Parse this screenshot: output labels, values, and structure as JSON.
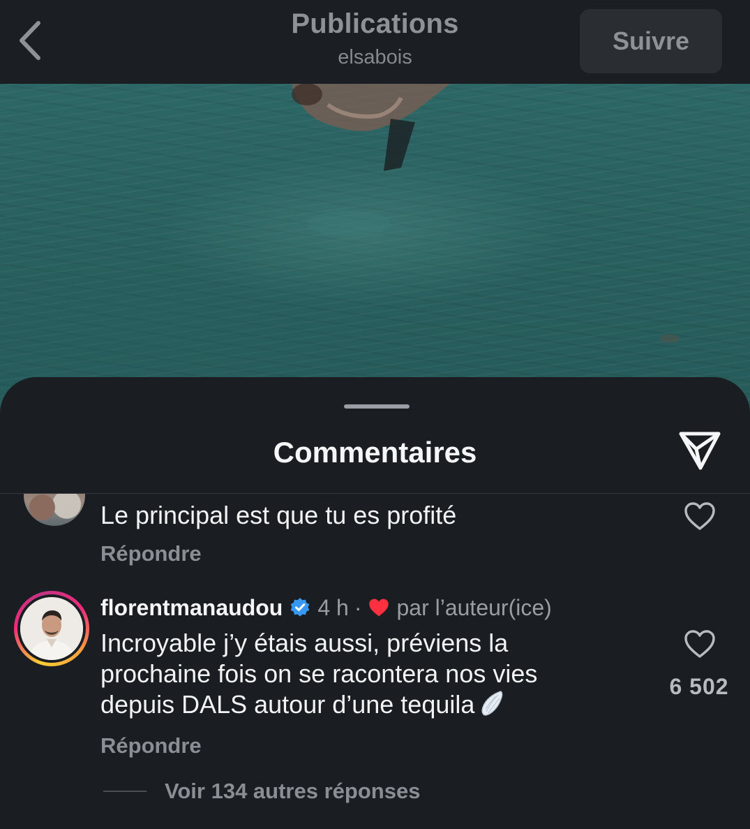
{
  "header": {
    "title": "Publications",
    "username": "elsabois",
    "follow_label": "Suivre"
  },
  "sheet": {
    "title": "Commentaires"
  },
  "comments": [
    {
      "text": "Le principal est que tu es profité",
      "reply_label": "Répondre"
    },
    {
      "username": "florentmanaudou",
      "verified": true,
      "time": "4 h",
      "separator": "·",
      "liked_by_author_label": "par l’auteur(ice)",
      "text": "Incroyable j’y étais aussi, préviens la prochaine fois on se racontera nos vies depuis DALS autour d’une tequila",
      "emoji": "wing-icon",
      "like_count": "6 502",
      "reply_label": "Répondre",
      "view_replies_label": "Voir 134 autres réponses"
    }
  ],
  "colors": {
    "verified_blue": "#3897f0",
    "like_red": "#ff3040",
    "story_ring": [
      "#f9ce34",
      "#ee2a7b",
      "#c13584"
    ]
  }
}
